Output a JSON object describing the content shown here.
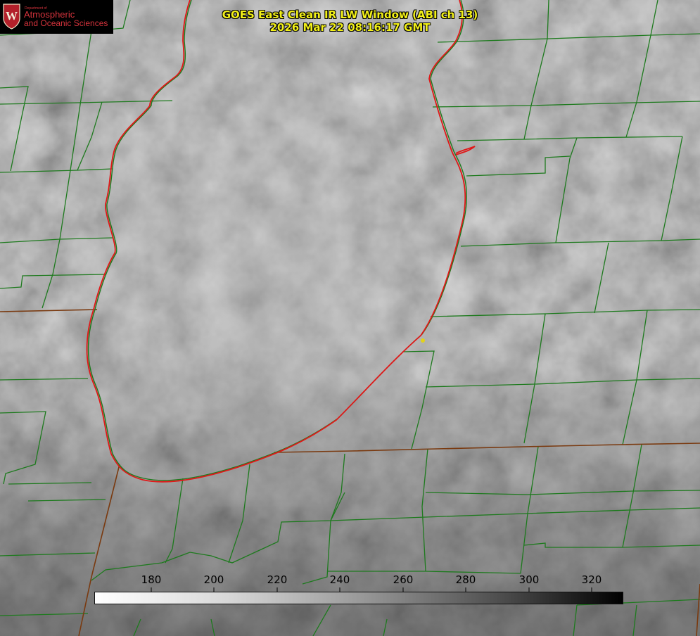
{
  "logo": {
    "dept_small": "Department of",
    "line1": "Atmospheric",
    "line2": "and Oceanic Sciences",
    "seal_letter": "W",
    "brand_color": "#d5333c"
  },
  "title": {
    "line1": "GOES East Clean IR LW Window (ABI ch 13)",
    "line2": "2026 Mar 22 08:16:17 GMT",
    "color": "#f2f018"
  },
  "colorbar": {
    "ticks": [
      "180",
      "200",
      "220",
      "240",
      "260",
      "280",
      "300",
      "320"
    ],
    "min": 162,
    "max": 330,
    "gradient": "white-to-black"
  },
  "map": {
    "boundary_color": "#1e7a1e",
    "lake_outline_color": "#e01818",
    "marker_color": "#e2d21a"
  }
}
